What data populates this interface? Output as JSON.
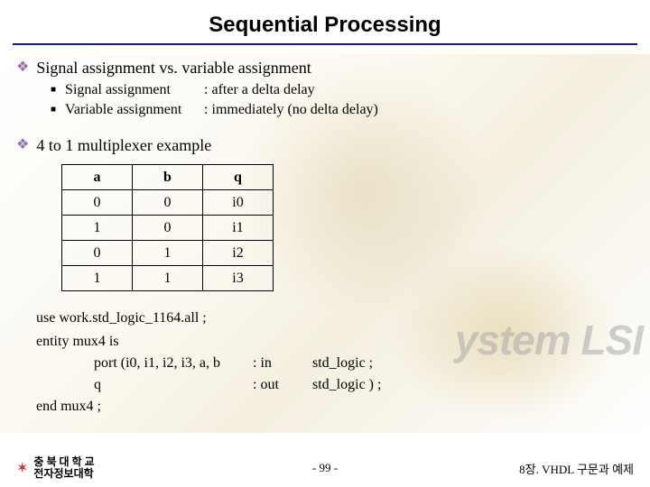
{
  "title": "Sequential Processing",
  "bullets": {
    "main1": "Signal assignment vs. variable assignment",
    "sub1_label": "Signal assignment",
    "sub1_desc": ": after a delta delay",
    "sub2_label": "Variable assignment",
    "sub2_desc": ": immediately (no delta delay)",
    "main2": "4 to 1 multiplexer example"
  },
  "chart_data": {
    "type": "table",
    "headers": [
      "a",
      "b",
      "q"
    ],
    "rows": [
      [
        "0",
        "0",
        "i0"
      ],
      [
        "1",
        "0",
        "i1"
      ],
      [
        "0",
        "1",
        "i2"
      ],
      [
        "1",
        "1",
        "i3"
      ]
    ]
  },
  "code": {
    "line1_a": "use work.",
    "line1_b": "std_logic_1164.",
    "line1_c": "all ;",
    "line2_a": "entity",
    "line2_b": " mux4 ",
    "line2_c": "is",
    "port_kw": "port",
    "port1_sig": "(i0, i1, i2, i3, a, b",
    "port1_dir": ": in",
    "port1_type": "std_logic ;",
    "port2_sig": "q",
    "port2_dir": ": out",
    "port2_type": "std_logic ) ;",
    "line_end_a": "end",
    "line_end_b": " mux4 ;"
  },
  "footer": {
    "left_line1": "충 북 대 학 교",
    "left_line2": "전자정보대학",
    "center": "- 99 -",
    "right": "8장. VHDL 구문과 예제"
  },
  "watermark": "ystem LSI"
}
